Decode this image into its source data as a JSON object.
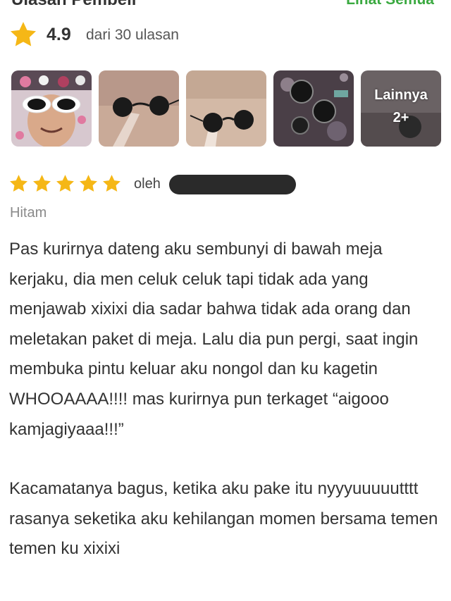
{
  "section": {
    "title": "Ulasan Pembeli",
    "see_all": "Lihat Semua"
  },
  "rating": {
    "value": "4.9",
    "count_text": "dari 30 ulasan",
    "star_color": "#f5b716"
  },
  "gallery": {
    "more_label": "Lainnya",
    "more_count": "2+"
  },
  "review": {
    "stars": 5,
    "by_label": "oleh",
    "reviewer_name": "",
    "variant": "Hitam",
    "paragraphs": [
      "Pas kurirnya dateng aku sembunyi di bawah meja kerjaku, dia men celuk celuk tapi tidak ada yang menjawab xixixi dia sadar bahwa tidak ada orang dan meletakan paket di meja. Lalu dia pun pergi, saat ingin membuka pintu keluar aku nongol dan ku kagetin WHOOAAAA!!!! mas kurirnya pun terkaget “aigooo kamjagiyaaa!!!”",
      "Kacamatanya bagus, ketika aku pake itu nyyyuuuuutttt rasanya seketika aku kehilangan momen bersama temen temen ku xixixi"
    ]
  },
  "colors": {
    "accent": "#3aa940",
    "star": "#f5b716",
    "muted": "#8a8a8a"
  }
}
